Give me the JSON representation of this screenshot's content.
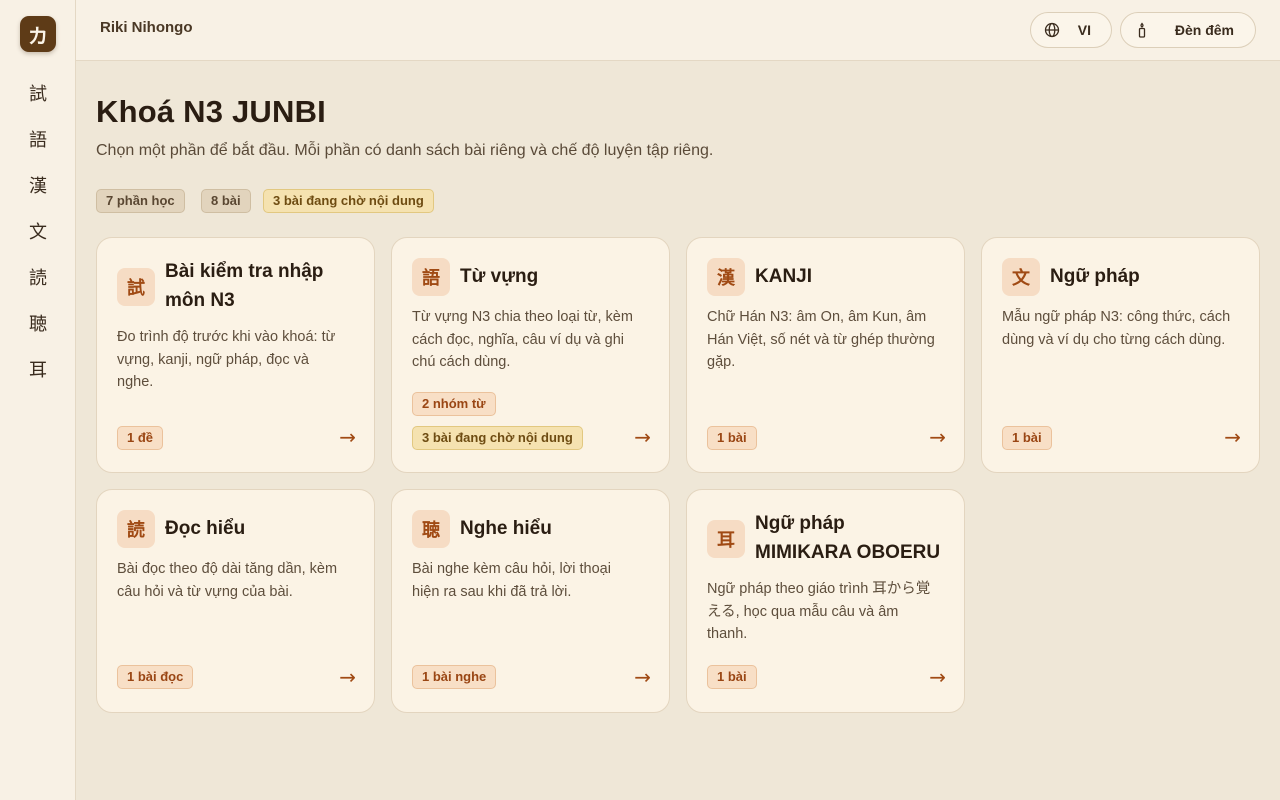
{
  "sidebar": {
    "logo": "カ",
    "items": [
      "試",
      "語",
      "漢",
      "文",
      "読",
      "聴",
      "耳"
    ]
  },
  "header": {
    "brand": "Riki Nihongo",
    "lang_label": "VI",
    "night_label": "Đèn đêm"
  },
  "main": {
    "title": "Khoá N3 JUNBI",
    "subtitle": "Chọn một phần để bắt đầu. Mỗi phần có danh sách bài riêng và chế độ luyện tập riêng.",
    "chips": [
      "7 phần học",
      "8 bài",
      "3 bài đang chờ nội dung"
    ]
  },
  "cards": [
    {
      "kanji": "試",
      "title": "Bài kiểm tra nhập môn N3",
      "desc": "Đo trình độ trước khi vào khoá: từ vựng, kanji, ngữ pháp, đọc và nghe.",
      "tags": [
        "1 đề"
      ]
    },
    {
      "kanji": "語",
      "title": "Từ vựng",
      "desc": "Từ vựng N3 chia theo loại từ, kèm cách đọc, nghĩa, câu ví dụ và ghi chú cách dùng.",
      "tags": [
        "2 nhóm từ",
        "3 bài đang chờ nội dung"
      ]
    },
    {
      "kanji": "漢",
      "title": "KANJI",
      "desc": "Chữ Hán N3: âm On, âm Kun, âm Hán Việt, số nét và từ ghép thường gặp.",
      "tags": [
        "1 bài"
      ]
    },
    {
      "kanji": "文",
      "title": "Ngữ pháp",
      "desc": "Mẫu ngữ pháp N3: công thức, cách dùng và ví dụ cho từng cách dùng.",
      "tags": [
        "1 bài"
      ]
    },
    {
      "kanji": "読",
      "title": "Đọc hiểu",
      "desc": "Bài đọc theo độ dài tăng dần, kèm câu hỏi và từ vựng của bài.",
      "tags": [
        "1 bài đọc"
      ]
    },
    {
      "kanji": "聴",
      "title": "Nghe hiểu",
      "desc": "Bài nghe kèm câu hỏi, lời thoại hiện ra sau khi đã trả lời.",
      "tags": [
        "1 bài nghe"
      ]
    },
    {
      "kanji": "耳",
      "title": "Ngữ pháp MIMIKARA OBOERU",
      "desc": "Ngữ pháp theo giáo trình 耳から覚える, học qua mẫu câu và âm thanh.",
      "tags": [
        "1 bài"
      ]
    }
  ],
  "arrow": "→",
  "colors": {
    "accent": "#a04a14",
    "logo_bg": "#5e3b17",
    "page_bg": "#efe7d7",
    "card_bg": "#fbf3e5"
  }
}
